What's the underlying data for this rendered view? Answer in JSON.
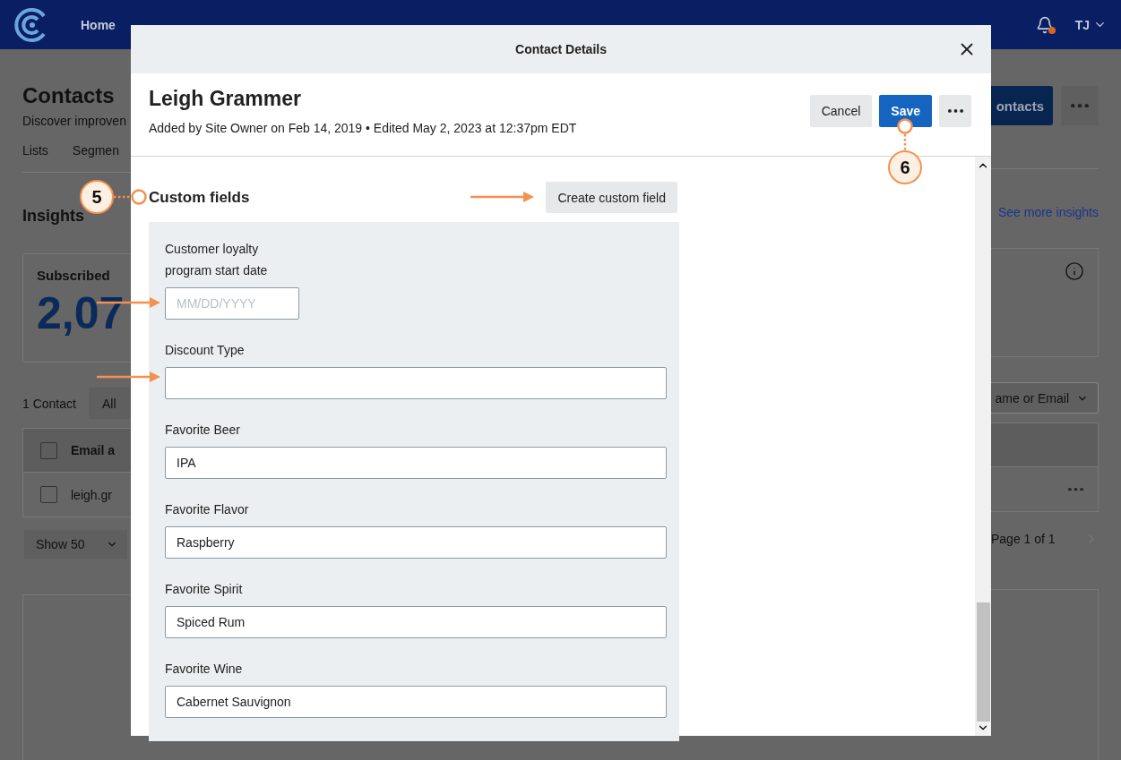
{
  "nav": {
    "items": [
      "Home"
    ],
    "notification": true,
    "avatar": "TJ"
  },
  "background_page": {
    "title": "Contacts",
    "subtitle": "Discover improven",
    "tabs": [
      "Lists",
      "Segmen"
    ],
    "primary_button": "ontacts",
    "insights_heading": "Insights",
    "see_more": "See more insights",
    "card": {
      "label": "Subscribed",
      "value": "2,07"
    },
    "contact_count": "1 Contact",
    "filter": "All",
    "search_select": "ame or Email",
    "table": {
      "header": "Email a",
      "header_checked": false,
      "rows": [
        {
          "email": "leigh.gr",
          "checked": false
        }
      ]
    },
    "page_size": "Show 50",
    "pagination": "Page 1 of 1"
  },
  "modal": {
    "title": "Contact Details",
    "contact_name": "Leigh Grammer",
    "meta": "Added by Site Owner on Feb 14, 2019 • Edited May 2, 2023 at 12:37pm EDT",
    "buttons": [
      {
        "label": "Cancel",
        "kind": "secondary"
      },
      {
        "label": "Save",
        "kind": "primary"
      }
    ],
    "section_heading": "Custom fields",
    "create_button": "Create custom field",
    "fields": [
      {
        "label": "Customer loyalty program start date",
        "placeholder": "MM/DD/YYYY",
        "kind": "date"
      },
      {
        "label": "Discount Type",
        "kind": "text"
      },
      {
        "label": "Favorite Beer",
        "value": "IPA",
        "kind": "text"
      },
      {
        "label": "Favorite Flavor",
        "value": "Raspberry",
        "kind": "text"
      },
      {
        "label": "Favorite Spirit",
        "value": "Spiced Rum",
        "kind": "text"
      },
      {
        "label": "Favorite Wine",
        "value": "Cabernet Sauvignon",
        "kind": "text"
      }
    ]
  },
  "callouts": [
    {
      "number": "5"
    },
    {
      "number": "6"
    }
  ]
}
